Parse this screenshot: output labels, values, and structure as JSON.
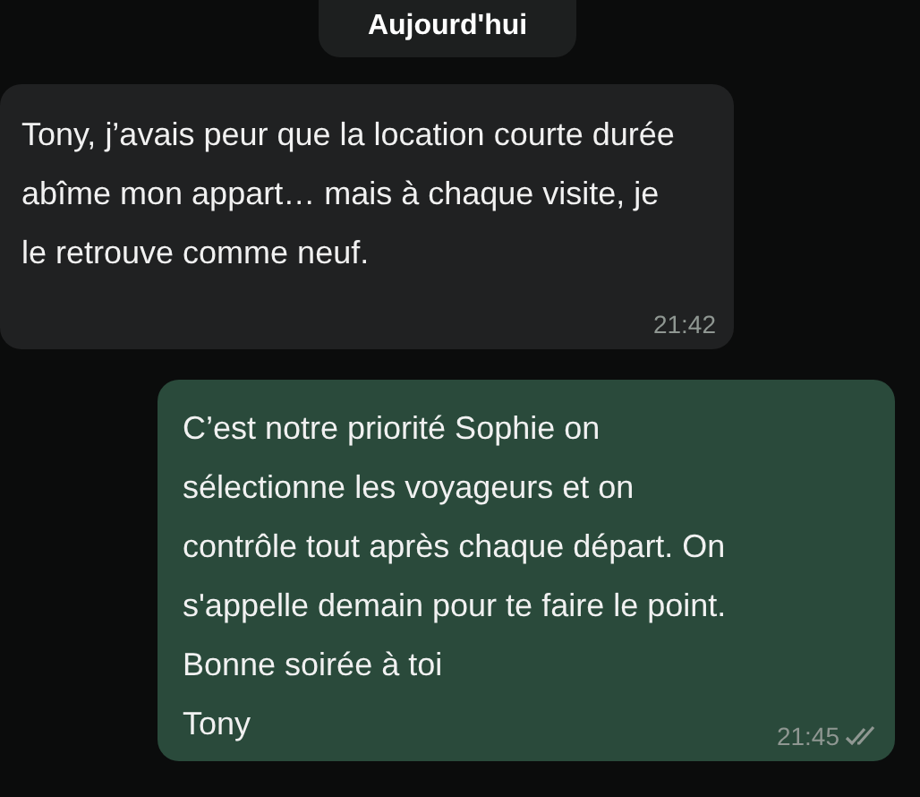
{
  "date_chip": "Aujourd'hui",
  "messages": [
    {
      "kind": "incoming",
      "text": "Tony, j’avais peur que la location courte durée abîme mon appart… mais à chaque visite, je le retrouve comme neuf.",
      "time": "21:42"
    },
    {
      "kind": "outgoing",
      "text": "C’est notre priorité Sophie on sélectionne les voyageurs et on contrôle tout après chaque départ. On s'appelle demain pour te faire le point. Bonne soirée à toi\nTony",
      "time": "21:45",
      "read": false
    }
  ]
}
